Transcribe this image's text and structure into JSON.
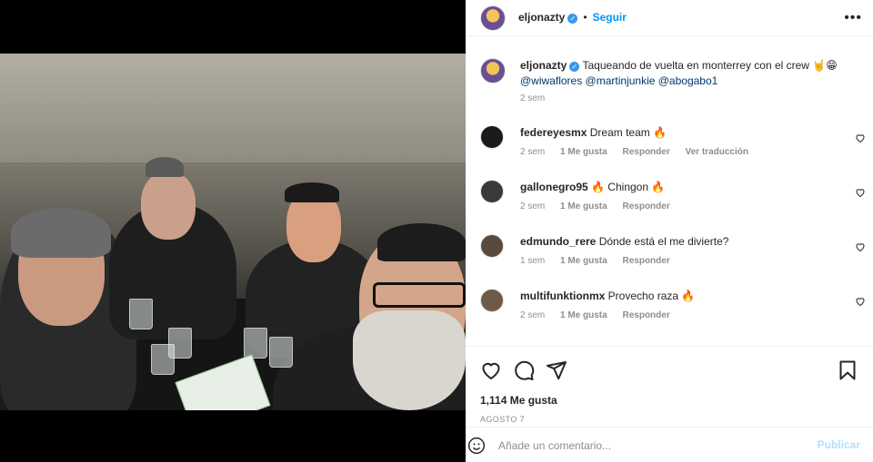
{
  "header": {
    "username": "eljonazty",
    "separator": "•",
    "follow_label": "Seguir",
    "more_label": "•••"
  },
  "caption": {
    "username": "eljonazty",
    "text": "Taqueando de vuelta en monterrey con el crew 🤘😁",
    "mentions": "@wiwaflores @martinjunkie @abogabo1",
    "time": "2 sem"
  },
  "comments": [
    {
      "username": "federeyesmx",
      "text": "Dream team 🔥",
      "time": "2 sem",
      "likes": "1 Me gusta",
      "reply": "Responder",
      "translate": "Ver traducción"
    },
    {
      "username": "gallonegro95",
      "text": "🔥 Chingon 🔥",
      "time": "2 sem",
      "likes": "1 Me gusta",
      "reply": "Responder"
    },
    {
      "username": "edmundo_rere",
      "text": "Dónde está el me divierte?",
      "time": "1 sem",
      "likes": "1 Me gusta",
      "reply": "Responder"
    },
    {
      "username": "multifunktionmx",
      "text": "Provecho raza 🔥",
      "time": "2 sem",
      "likes": "1 Me gusta",
      "reply": "Responder"
    }
  ],
  "actions": {
    "like_icon": "heart-outline-icon",
    "comment_icon": "speech-bubble-icon",
    "share_icon": "paper-plane-icon",
    "save_icon": "bookmark-icon"
  },
  "likes_text": "1,114 Me gusta",
  "date_text": "AGOSTO 7",
  "comment_input": {
    "placeholder": "Añade un comentario...",
    "value": "",
    "post_label": "Publicar"
  },
  "colors": {
    "accent": "#0095f6",
    "post_disabled": "#b2dffc",
    "muted": "#8e8e8e",
    "border": "#efefef"
  }
}
